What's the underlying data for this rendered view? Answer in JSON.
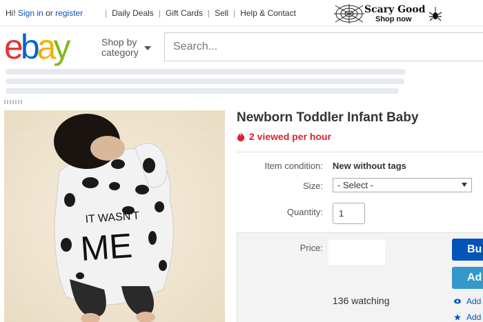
{
  "topbar": {
    "greeting_prefix": "Hi!",
    "sign_in": "Sign in",
    "or": "or",
    "register": "register",
    "links": [
      "Daily Deals",
      "Gift Cards",
      "Sell",
      "Help & Contact"
    ],
    "promo_title": "Scary Good",
    "promo_sub": "Shop now"
  },
  "header": {
    "logo": {
      "e": "e",
      "b": "b",
      "a": "a",
      "y": "y"
    },
    "shop_by": "Shop by",
    "category": "category",
    "search_placeholder": "Search..."
  },
  "product": {
    "title": "Newborn Toddler Infant Baby",
    "views": "2 viewed per hour",
    "condition_label": "Item condition:",
    "condition_value": "New without tags",
    "size_label": "Size:",
    "size_selected": "- Select -",
    "quantity_label": "Quantity:",
    "quantity_value": "1",
    "price_label": "Price:",
    "watching": "136 watching",
    "buy_label": "Bu",
    "add_label": "Ad",
    "add_link_1": "Add",
    "add_link_2": "Add"
  },
  "image": {
    "onesie_text_1": "IT WASN'T",
    "onesie_text_2": "ME"
  },
  "colors": {
    "logo_e": "#e53238",
    "logo_b": "#0064d2",
    "logo_a": "#f5af02",
    "logo_y": "#86b817",
    "link_blue": "#0654ba",
    "views_red": "#dd1e31",
    "buy_button": "#0654ba",
    "add_button": "#3498ca"
  }
}
